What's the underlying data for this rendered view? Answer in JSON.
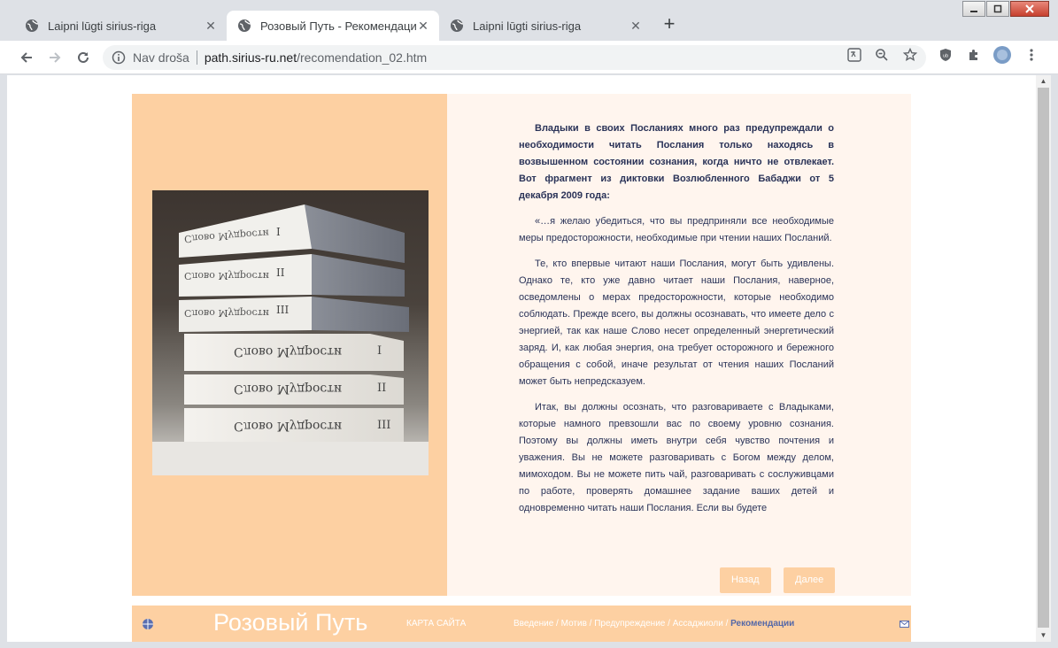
{
  "browser": {
    "tabs": [
      {
        "title": "Laipni lūgti sirius-riga",
        "close": "✕"
      },
      {
        "title": "Розовый Путь - Рекомендации",
        "close": "✕"
      },
      {
        "title": "Laipni lūgti sirius-riga",
        "close": "✕"
      }
    ],
    "new_tab": "+",
    "address": {
      "security_label": "Nav droša",
      "host": "path.sirius-ru.net",
      "path": "/recomendation_02.htm"
    }
  },
  "article": {
    "lead": "Владыки в своих Посланиях много раз предупреждали о необходимости читать Послания только находясь в возвышенном состоянии сознания, когда ничто не отвлекает. Вот фрагмент из диктовки Возлюбленного Бабаджи от 5 декабря 2009 года:",
    "p1": "«…я желаю убедиться, что вы предприняли все необходимые меры предосторожности, необходимые при чтении наших Посланий.",
    "p2": "Те, кто впервые читают наши Послания, могут быть удивлены. Однако те, кто уже давно читает наши Послания, наверное, осведомлены о мерах предосторожности, которые необходимо соблюдать. Прежде всего, вы должны осознавать, что имеете дело с энергией, так как наше Слово несет определенный энергетический заряд. И, как любая энергия, она требует осторожного и бережного обращения с собой, иначе результат от чтения наших Посланий может быть непредсказуем.",
    "p3": "Итак, вы должны осознать, что разговариваете с Владыками, которые намного превзошли вас по своему уровню сознания. Поэтому вы должны иметь внутри себя чувство почтения и уважения. Вы не можете разговаривать с Богом между делом, мимоходом. Вы не можете пить чай, разговаривать с сослуживцами по работе, проверять домашнее задание ваших детей и одновременно читать наши Послания. Если вы будете"
  },
  "buttons": {
    "back": "Назад",
    "next": "Далее"
  },
  "book": {
    "title": "Слово Мудрости",
    "volumes": [
      "I",
      "II",
      "III"
    ]
  },
  "footer": {
    "logo": "Розовый Путь",
    "sitemap": "КАРТА САЙТА",
    "crumbs": [
      {
        "label": "Введение"
      },
      {
        "label": "Мотив"
      },
      {
        "label": "Предупреждение"
      },
      {
        "label": "Ассаджиоли"
      },
      {
        "label": "Рекомендации"
      }
    ],
    "sep": " / "
  },
  "colors": {
    "peach": "#fdd0a2",
    "cream": "#fff5ee",
    "text": "#2a3358",
    "current_crumb": "#5468a8"
  }
}
